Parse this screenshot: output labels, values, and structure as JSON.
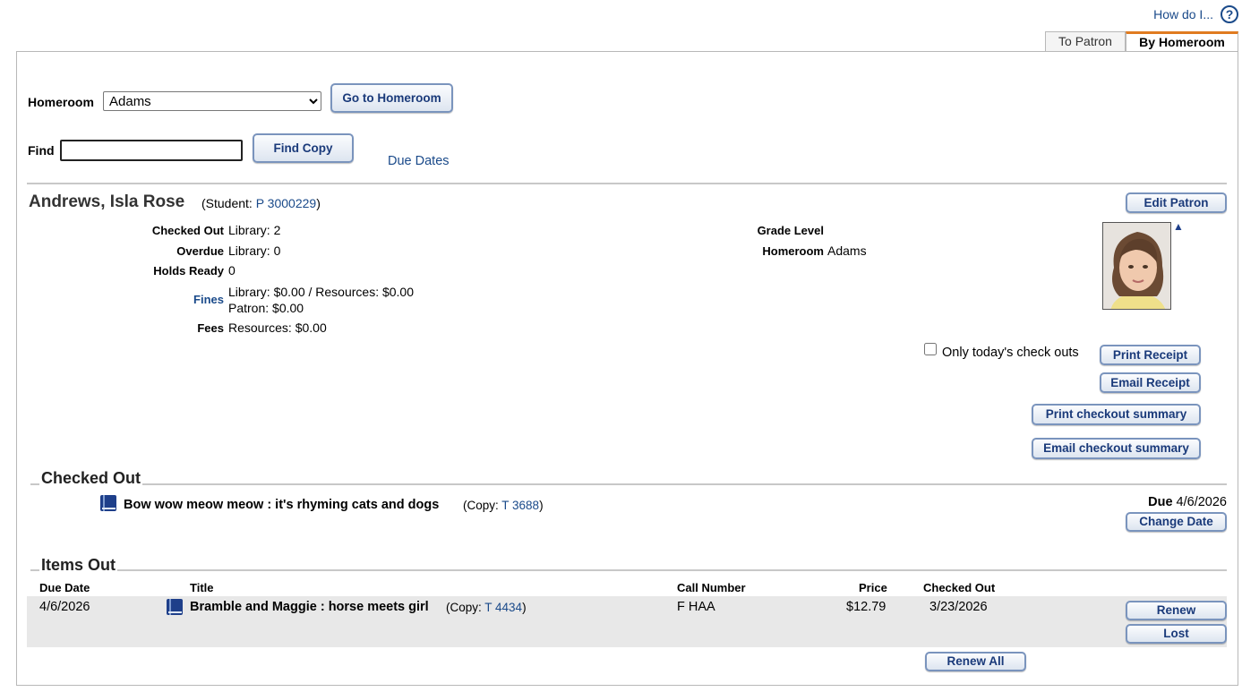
{
  "help": {
    "label": "How do I...",
    "icon": "question-icon"
  },
  "tabs": [
    {
      "label": "To Patron",
      "active": false
    },
    {
      "label": "By Homeroom",
      "active": true
    }
  ],
  "homeroom": {
    "label": "Homeroom",
    "selected": "Adams",
    "go_button": "Go to Homeroom"
  },
  "find": {
    "label": "Find",
    "value": "",
    "button": "Find Copy",
    "due_dates_link": "Due Dates"
  },
  "patron": {
    "name": "Andrews, Isla Rose",
    "type_prefix": "(Student: ",
    "barcode": "P 3000229",
    "type_suffix": ")",
    "edit_button": "Edit Patron",
    "checked_out_label": "Checked Out",
    "checked_out_value": "Library: 2",
    "overdue_label": "Overdue",
    "overdue_value": "Library: 0",
    "holds_label": "Holds Ready",
    "holds_value": "0",
    "fines_label": "Fines",
    "fines_line1": "Library: $0.00 / Resources: $0.00",
    "fines_line2": "Patron: $0.00",
    "fees_label": "Fees",
    "fees_value": "Resources: $0.00",
    "grade_label": "Grade Level",
    "grade_value": "",
    "homeroom_label": "Homeroom",
    "homeroom_value": "Adams",
    "photo_toggle": "▲"
  },
  "receipts": {
    "only_today_label": "Only today's check outs",
    "print_receipt": "Print Receipt",
    "email_receipt": "Email Receipt",
    "print_summary": "Print checkout summary",
    "email_summary": "Email checkout summary"
  },
  "checked_out": {
    "title": "Checked Out",
    "item_title": "Bow wow meow meow : it's rhyming cats and dogs",
    "copy_prefix": "(Copy: ",
    "copy": "T 3688",
    "copy_suffix": ")",
    "due_label": "Due",
    "due_date": "4/6/2026",
    "change_date_button": "Change Date"
  },
  "items_out": {
    "title": "Items Out",
    "headers": {
      "due_date": "Due Date",
      "title": "Title",
      "call_number": "Call Number",
      "price": "Price",
      "checked_out": "Checked Out"
    },
    "rows": [
      {
        "due_date": "4/6/2026",
        "title": "Bramble and Maggie : horse meets girl",
        "copy_prefix": "(Copy: ",
        "copy": "T 4434",
        "copy_suffix": ")",
        "call_number": "F HAA",
        "price": "$12.79",
        "checked_out": "3/23/2026",
        "renew_button": "Renew",
        "lost_button": "Lost"
      }
    ],
    "renew_all_button": "Renew All"
  }
}
